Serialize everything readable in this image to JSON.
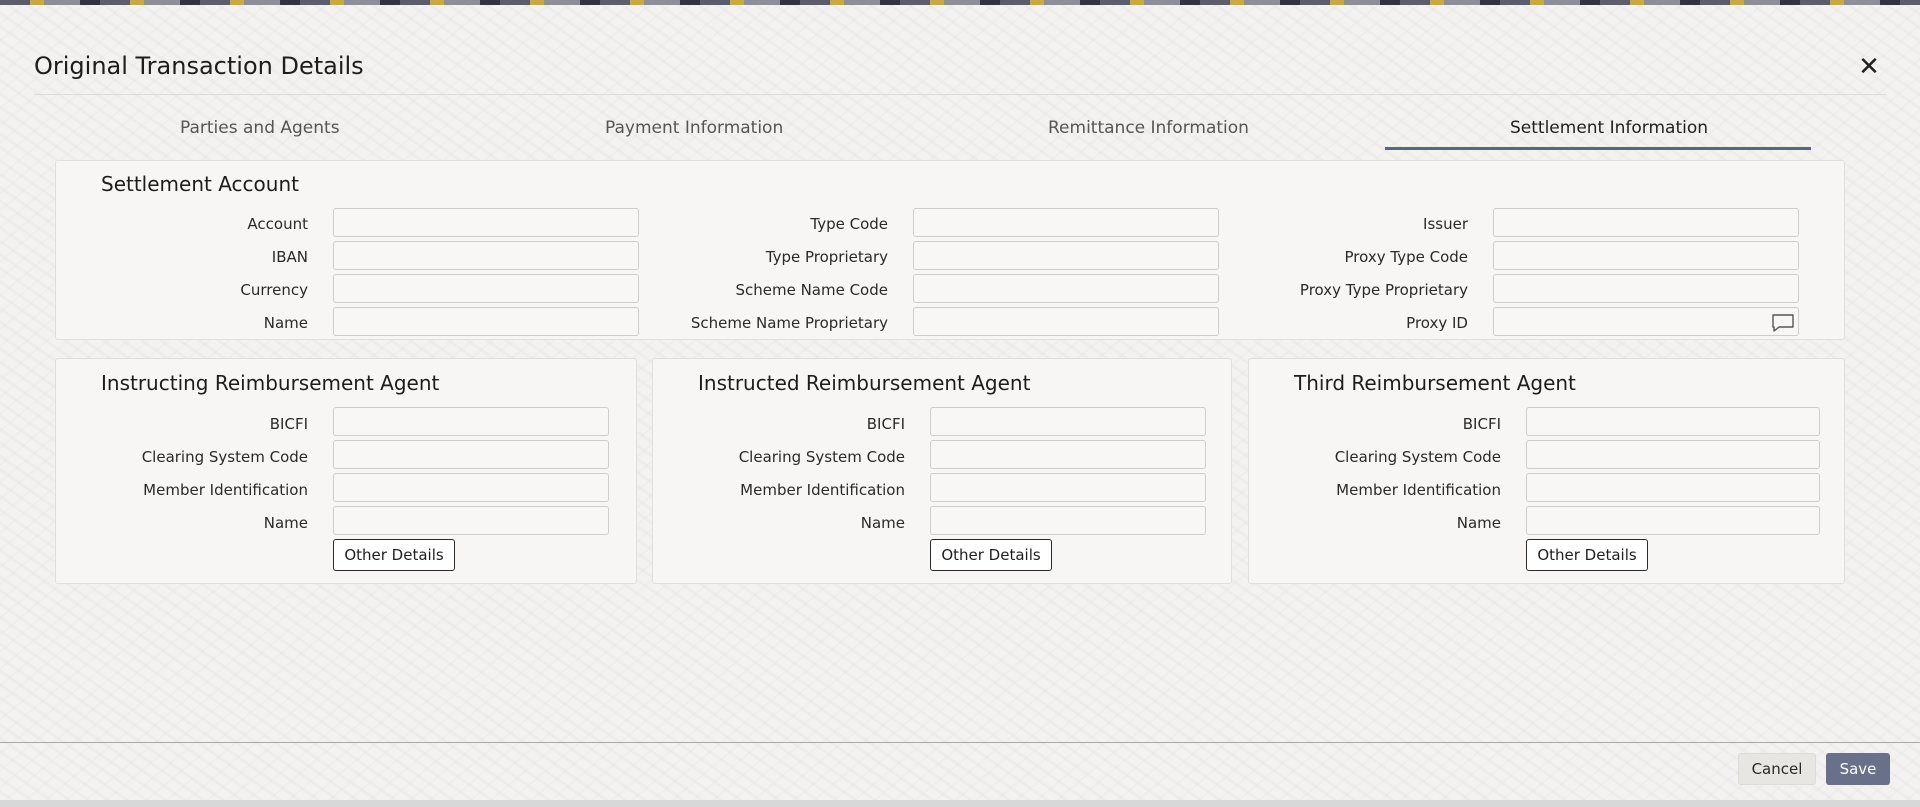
{
  "dialog": {
    "title": "Original Transaction Details"
  },
  "tabs": [
    {
      "label": "Parties and Agents"
    },
    {
      "label": "Payment Information"
    },
    {
      "label": "Remittance Information"
    },
    {
      "label": "Settlement Information",
      "active": true
    }
  ],
  "settlement_account": {
    "title": "Settlement Account",
    "fields": {
      "account": {
        "label": "Account",
        "value": ""
      },
      "iban": {
        "label": "IBAN",
        "value": ""
      },
      "currency": {
        "label": "Currency",
        "value": ""
      },
      "name": {
        "label": "Name",
        "value": ""
      },
      "type_code": {
        "label": "Type Code",
        "value": ""
      },
      "type_proprietary": {
        "label": "Type Proprietary",
        "value": ""
      },
      "scheme_name_code": {
        "label": "Scheme Name Code",
        "value": ""
      },
      "scheme_name_proprietary": {
        "label": "Scheme Name Proprietary",
        "value": ""
      },
      "issuer": {
        "label": "Issuer",
        "value": ""
      },
      "proxy_type_code": {
        "label": "Proxy Type Code",
        "value": ""
      },
      "proxy_type_proprietary": {
        "label": "Proxy Type Proprietary",
        "value": ""
      },
      "proxy_id": {
        "label": "Proxy ID",
        "value": ""
      }
    }
  },
  "agents": [
    {
      "title": "Instructing Reimbursement Agent",
      "bicfi": {
        "label": "BICFI",
        "value": ""
      },
      "clearing_system_code": {
        "label": "Clearing System Code",
        "value": ""
      },
      "member_identification": {
        "label": "Member Identification",
        "value": ""
      },
      "name": {
        "label": "Name",
        "value": ""
      },
      "other_details_label": "Other Details"
    },
    {
      "title": "Instructed Reimbursement Agent",
      "bicfi": {
        "label": "BICFI",
        "value": ""
      },
      "clearing_system_code": {
        "label": "Clearing System Code",
        "value": ""
      },
      "member_identification": {
        "label": "Member Identification",
        "value": ""
      },
      "name": {
        "label": "Name",
        "value": ""
      },
      "other_details_label": "Other Details"
    },
    {
      "title": "Third Reimbursement Agent",
      "bicfi": {
        "label": "BICFI",
        "value": ""
      },
      "clearing_system_code": {
        "label": "Clearing System Code",
        "value": ""
      },
      "member_identification": {
        "label": "Member Identification",
        "value": ""
      },
      "name": {
        "label": "Name",
        "value": ""
      },
      "other_details_label": "Other Details"
    }
  ],
  "footer": {
    "cancel_label": "Cancel",
    "save_label": "Save"
  },
  "icons": {
    "close": "close-icon",
    "proxy_id_lookup": "chat-bubble-icon"
  },
  "colors": {
    "accent": "#68708a",
    "tab_underline": "#5c6580"
  }
}
